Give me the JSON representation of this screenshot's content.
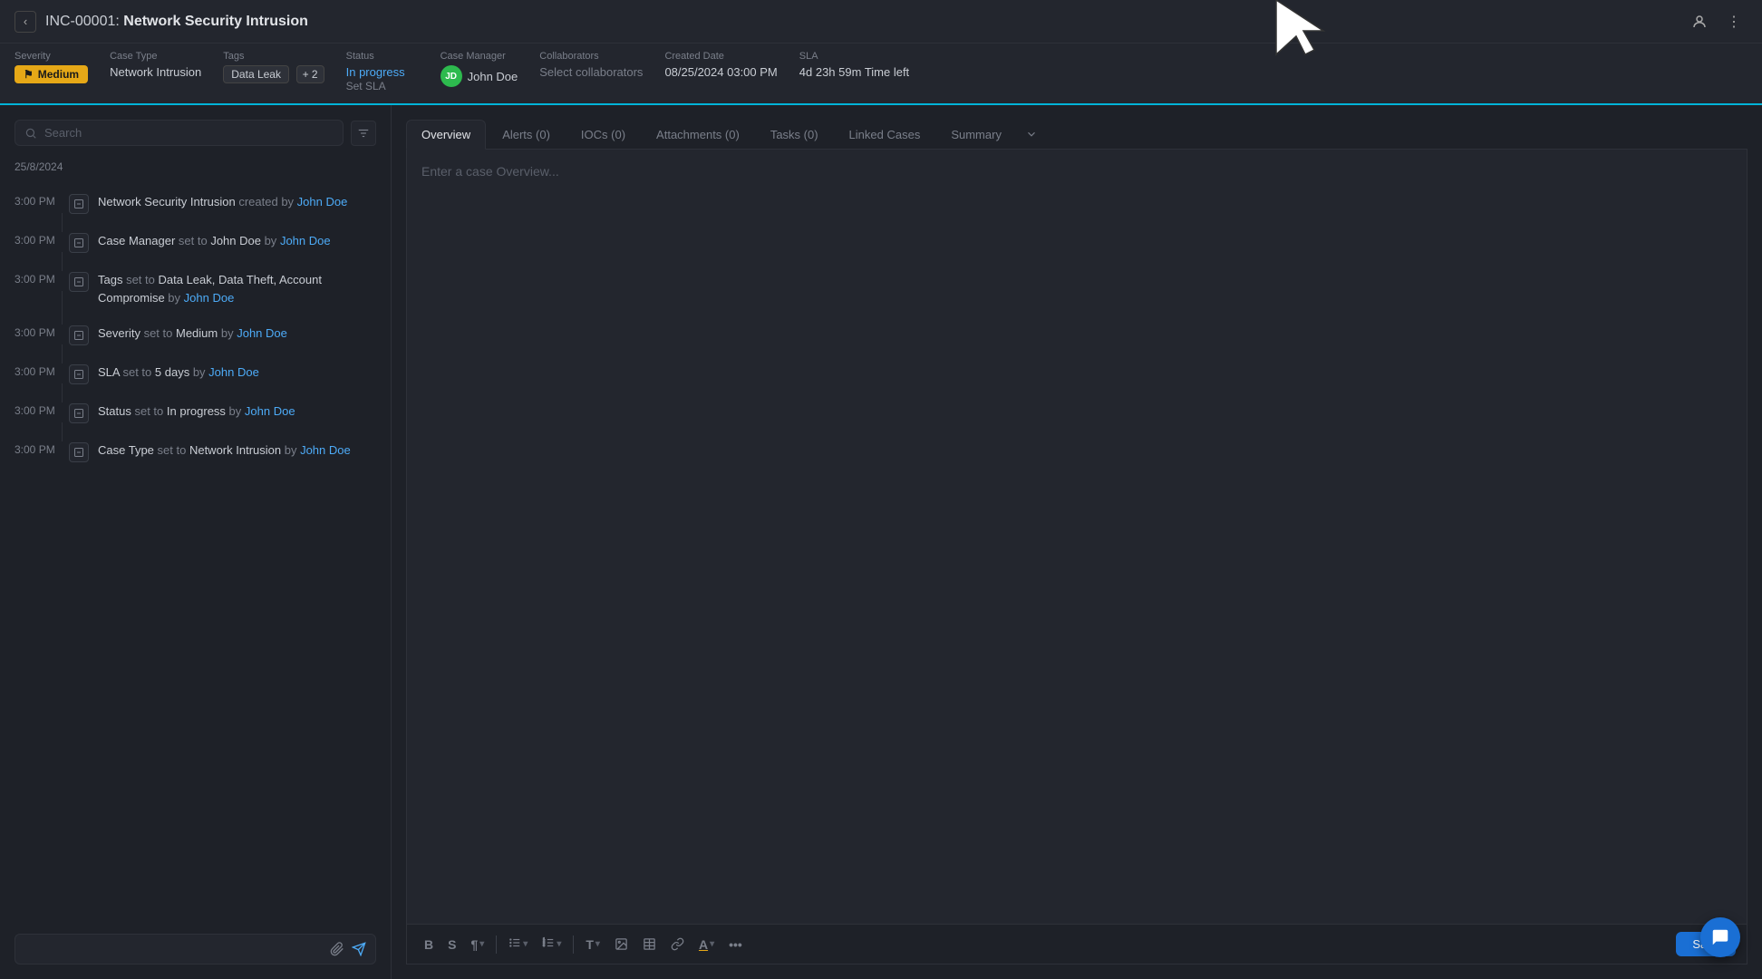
{
  "header": {
    "back_label": "‹",
    "case_id": "INC-00001:",
    "case_title": " Network Security Intrusion",
    "user_icon_label": "👤",
    "more_icon_label": "⋮"
  },
  "meta": {
    "severity_label": "Severity",
    "severity_value": "Medium",
    "case_type_label": "Case Type",
    "case_type_value": "Network Intrusion",
    "tags_label": "Tags",
    "tags": [
      {
        "label": "Data Leak"
      },
      {
        "label": "+ 2"
      }
    ],
    "status_label": "Status",
    "status_value": "In progress",
    "set_sla_label": "Set SLA",
    "case_manager_label": "Case Manager",
    "case_manager_avatar": "JD",
    "case_manager_name": "John Doe",
    "collaborators_label": "Collaborators",
    "collaborators_placeholder": "Select collaborators",
    "created_date_label": "Created Date",
    "created_date_value": "08/25/2024 03:00 PM",
    "sla_label": "SLA",
    "sla_value": "4d 23h 59m",
    "sla_suffix": " Time left"
  },
  "left_panel": {
    "search_placeholder": "Search",
    "filter_icon": "≡",
    "date_group": "25/8/2024",
    "timeline": [
      {
        "time": "3:00 PM",
        "text_parts": [
          {
            "text": "Network Security Intrusion",
            "style": "normal"
          },
          {
            "text": " created by ",
            "style": "keyword"
          },
          {
            "text": "John Doe",
            "style": "actor"
          }
        ]
      },
      {
        "time": "3:00 PM",
        "text_parts": [
          {
            "text": "Case Manager",
            "style": "normal"
          },
          {
            "text": " set to ",
            "style": "keyword"
          },
          {
            "text": "John Doe",
            "style": "value"
          },
          {
            "text": " by ",
            "style": "keyword"
          },
          {
            "text": "John Doe",
            "style": "actor"
          }
        ]
      },
      {
        "time": "3:00 PM",
        "text_parts": [
          {
            "text": "Tags",
            "style": "normal"
          },
          {
            "text": " set to ",
            "style": "keyword"
          },
          {
            "text": "Data Leak, Data Theft, Account Compromise",
            "style": "value"
          },
          {
            "text": " by",
            "style": "keyword"
          },
          {
            "text": " John Doe",
            "style": "actor"
          }
        ]
      },
      {
        "time": "3:00 PM",
        "text_parts": [
          {
            "text": "Severity",
            "style": "normal"
          },
          {
            "text": " set to ",
            "style": "keyword"
          },
          {
            "text": "Medium",
            "style": "value"
          },
          {
            "text": " by ",
            "style": "keyword"
          },
          {
            "text": "John Doe",
            "style": "actor"
          }
        ]
      },
      {
        "time": "3:00 PM",
        "text_parts": [
          {
            "text": "SLA",
            "style": "normal"
          },
          {
            "text": " set to ",
            "style": "keyword"
          },
          {
            "text": "5 days",
            "style": "value"
          },
          {
            "text": " by ",
            "style": "keyword"
          },
          {
            "text": "John Doe",
            "style": "actor"
          }
        ]
      },
      {
        "time": "3:00 PM",
        "text_parts": [
          {
            "text": "Status",
            "style": "normal"
          },
          {
            "text": " set to ",
            "style": "keyword"
          },
          {
            "text": "In progress",
            "style": "value"
          },
          {
            "text": " by ",
            "style": "keyword"
          },
          {
            "text": "John Doe",
            "style": "actor"
          }
        ]
      },
      {
        "time": "3:00 PM",
        "text_parts": [
          {
            "text": "Case Type",
            "style": "normal"
          },
          {
            "text": " set to ",
            "style": "keyword"
          },
          {
            "text": "Network Intrusion",
            "style": "value"
          },
          {
            "text": " by ",
            "style": "keyword"
          },
          {
            "text": "John Doe",
            "style": "actor"
          }
        ]
      }
    ],
    "chat_input_placeholder": ""
  },
  "right_panel": {
    "tabs": [
      {
        "label": "Overview",
        "active": true,
        "id": "overview"
      },
      {
        "label": "Alerts (0)",
        "active": false,
        "id": "alerts"
      },
      {
        "label": "IOCs (0)",
        "active": false,
        "id": "iocs"
      },
      {
        "label": "Attachments (0)",
        "active": false,
        "id": "attachments"
      },
      {
        "label": "Tasks (0)",
        "active": false,
        "id": "tasks"
      },
      {
        "label": "Linked Cases",
        "active": false,
        "id": "linked-cases"
      },
      {
        "label": "Summary",
        "active": false,
        "id": "summary"
      }
    ],
    "more_tabs_icon": "⌄",
    "overview_placeholder": "Enter a case Overview...",
    "toolbar": {
      "bold": "B",
      "strikethrough": "S",
      "paragraph": "¶",
      "list_unordered": "☰",
      "list_ordered": "≡",
      "text_style": "T",
      "image": "🖼",
      "table": "⊞",
      "link": "🔗",
      "highlight": "A",
      "more": "•••",
      "save": "Save"
    }
  },
  "chat_bubble_icon": "💬"
}
